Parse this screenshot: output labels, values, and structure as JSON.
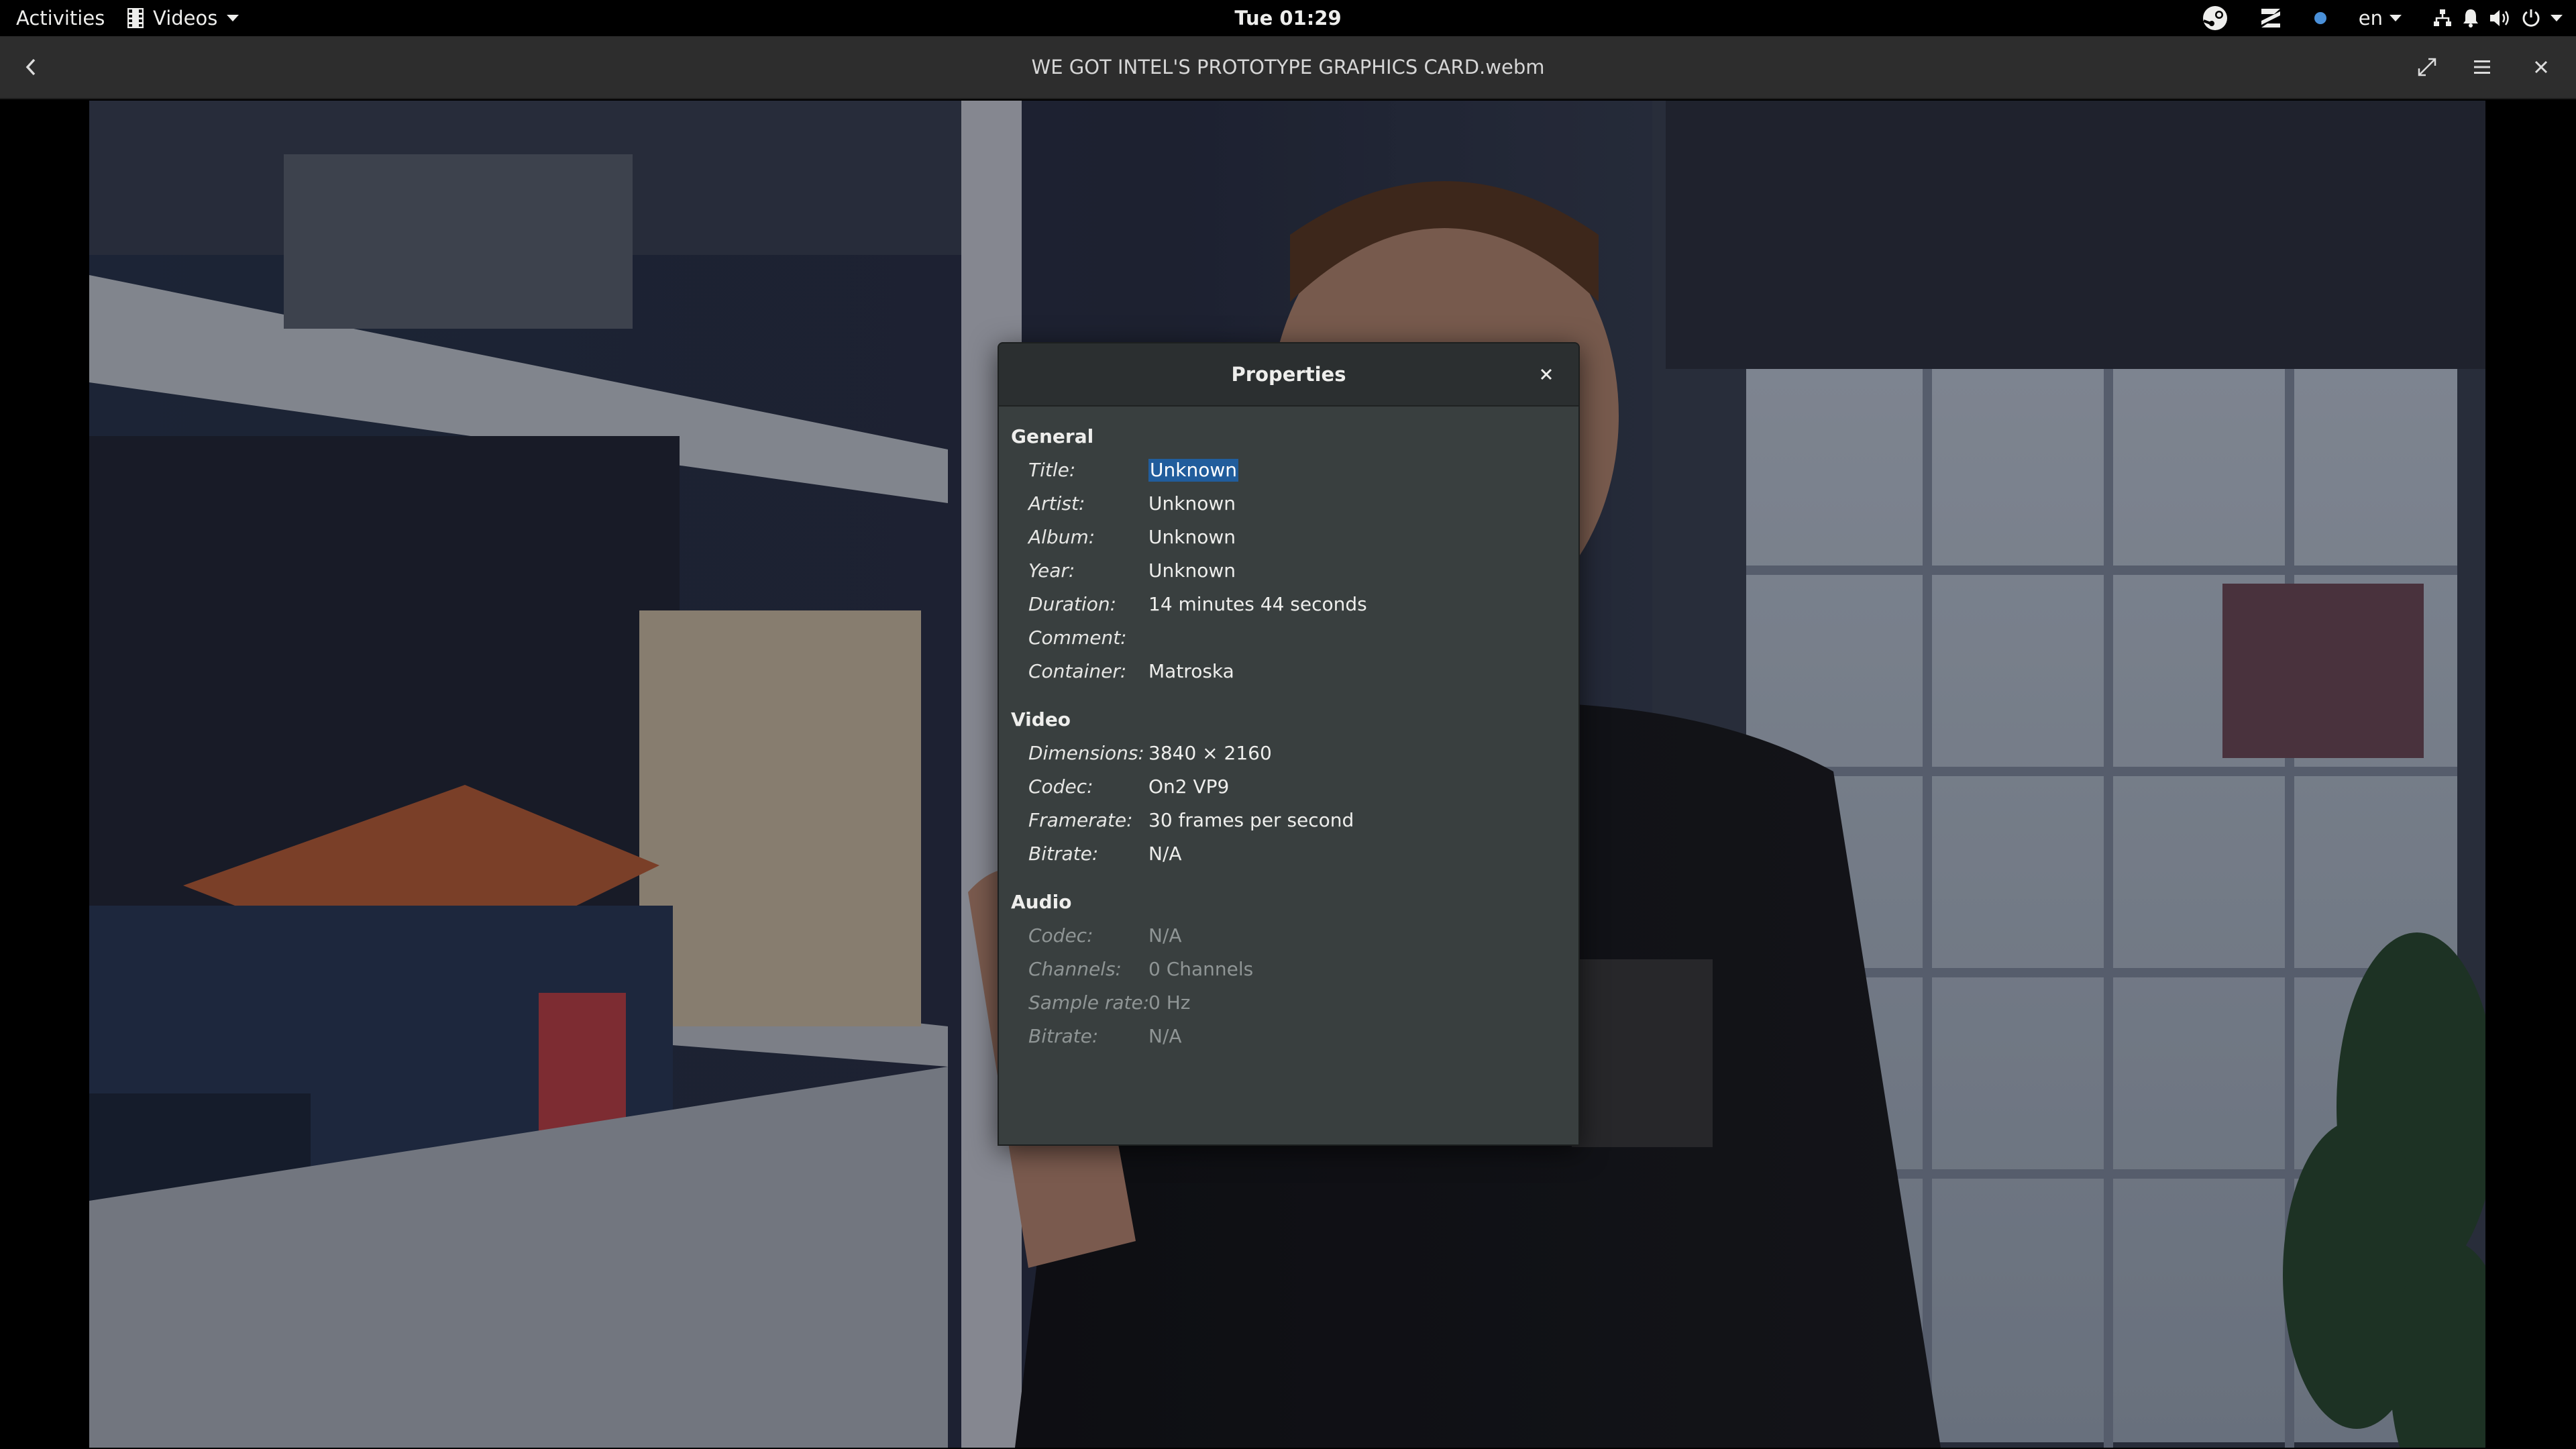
{
  "topbar": {
    "activities": "Activities",
    "app_name": "Videos",
    "clock": "Tue 01:29",
    "language": "en",
    "tray_icons": [
      "steam-icon",
      "zorin-icon",
      "dot-icon",
      "network-icon",
      "notification-icon",
      "volume-icon",
      "power-icon"
    ]
  },
  "headerbar": {
    "title": "WE GOT INTEL'S PROTOTYPE GRAPHICS CARD.webm"
  },
  "dialog": {
    "title": "Properties",
    "general": {
      "heading": "General",
      "title_label": "Title:",
      "title_value": "Unknown",
      "artist_label": "Artist:",
      "artist_value": "Unknown",
      "album_label": "Album:",
      "album_value": "Unknown",
      "year_label": "Year:",
      "year_value": "Unknown",
      "duration_label": "Duration:",
      "duration_value": "14 minutes 44 seconds",
      "comment_label": "Comment:",
      "comment_value": "",
      "container_label": "Container:",
      "container_value": "Matroska"
    },
    "video": {
      "heading": "Video",
      "dimensions_label": "Dimensions:",
      "dimensions_value": "3840 × 2160",
      "codec_label": "Codec:",
      "codec_value": "On2 VP9",
      "framerate_label": "Framerate:",
      "framerate_value": "30 frames per second",
      "bitrate_label": "Bitrate:",
      "bitrate_value": "N/A"
    },
    "audio": {
      "heading": "Audio",
      "codec_label": "Codec:",
      "codec_value": "N/A",
      "channels_label": "Channels:",
      "channels_value": "0 Channels",
      "samplerate_label": "Sample rate:",
      "samplerate_value": "0 Hz",
      "bitrate_label": "Bitrate:",
      "bitrate_value": "N/A"
    }
  },
  "colors": {
    "topbar_bg": "#000000",
    "headerbar_bg": "#2d2d2d",
    "dialog_bg": "#393f3f",
    "selection": "#215d9c",
    "dim_text": "#8f9595"
  }
}
